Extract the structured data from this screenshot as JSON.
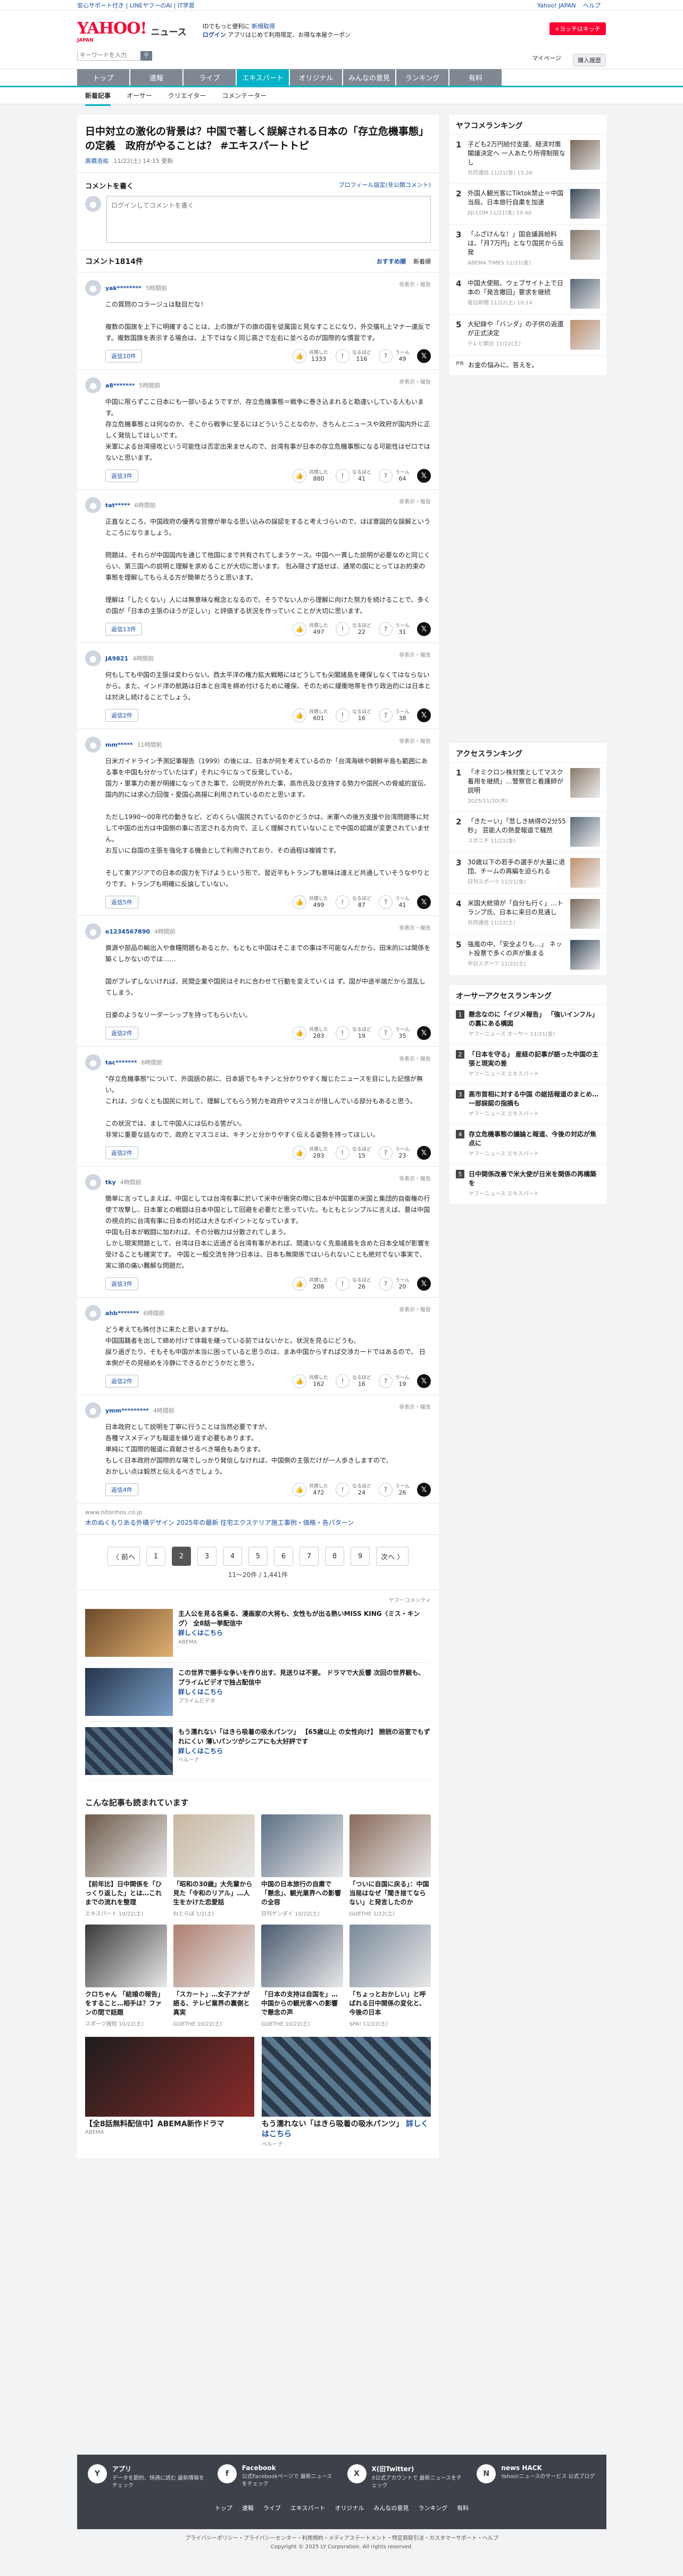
{
  "topbar": {
    "left_links": [
      "安心サポート付き | LINEヤフーのAI | IT学習"
    ],
    "right_links": [
      "Yahoo! JAPAN",
      "ヘルプ"
    ]
  },
  "header": {
    "logo": "YAHOO!",
    "logo_sub": "JAPAN",
    "section": "ニュース",
    "promo_line1": "IDでもっと便利に",
    "promo_new": "新規取得",
    "promo_login": "ログイン",
    "promo_line2": "アプリはじめて利用限定、お得な本屋クーポン",
    "search_button": "+ヨッチはキッチ",
    "right_text": "ポスト"
  },
  "searchrow": {
    "placeholder": "キーワードを入力",
    "mypage": "マイページ",
    "purchase": "購入履歴"
  },
  "nav": {
    "tabs": [
      "トップ",
      "速報",
      "ライブ",
      "エキスパート",
      "オリジナル",
      "みんなの意見",
      "ランキング",
      "有料"
    ],
    "active": "エキスパート"
  },
  "subnav": [
    "新着記事",
    "オーサー",
    "クリエイター",
    "コメンテーター"
  ],
  "article": {
    "title": "日中対立の激化の背景は？中国で著しく誤解される日本の「存立危機事態」の定義　政府がやることは？ #エキスパートトピ",
    "author": "高橋浩祐",
    "date": "11/22(土) 14:15 更新"
  },
  "comment_form": {
    "label": "コメントを書く",
    "link": "プロフィール設定(非公開コメント)",
    "placeholder": "ログインしてコメントを書く"
  },
  "comments_header": {
    "title": "コメント1814件",
    "sort1": "おすすめ順",
    "sort2": "新着順"
  },
  "vote_labels": {
    "agree": "共感した",
    "think": "なるほど",
    "hmm": "うーん",
    "report": "非表示・報告",
    "replies_label": "返信"
  },
  "comments": [
    {
      "user": "yak********",
      "time": "5時間前",
      "body": "この質問のコラージュは駄目だな！\n\n複数の国旗を上下に明確することは、上の旗が下の旗の国を従属国と見なすことになり、外交儀礼上マナー違反です。複数国旗を表示する場合は、上下ではなく同じ高さで左右に並べるのが国際的な慣習です。",
      "replies": "返信10件",
      "agree": "1333",
      "think": "116",
      "hmm": "49"
    },
    {
      "user": "a8*******",
      "time": "5時間前",
      "body": "中国に限らずここ日本にも一部いるようですが、存立危機事態＝戦争に巻き込まれると勘違いしている人もいます。\n存立危機事態とは何なのか、そこから戦争に至るにはどういうことなのか、きちんとニュースや政府が国内外に正しく発信してほしいです。\n米軍による台湾侵攻という可能性は否定出来ませんので、台湾有事が日本の存立危機事態になる可能性はゼロではないと思います。",
      "replies": "返信3件",
      "agree": "880",
      "think": "41",
      "hmm": "64"
    },
    {
      "user": "tat*****",
      "time": "6時間前",
      "body": "正直なところ、中国政府の優秀な官僚が単なる思い込みの誤認をすると考えづらいので、ほぼ意図的な誤解というところになりましょう。\n\n問題は、それらが中国国内を通じて他国にまで共有されてしまうケース。中国へ一貫した説明が必要なのと同じくらい、第三国への説明と理解を求めることが大切に思います。 包み隠さず話せば、通常の国にとってはお約束の事態を理解してもらえる方が簡単だろうと思います。\n\n理解は「したくない」人には無意味な概念となるので、そうでない人から理解に向けた努力を続けることで、多くの国が「日本の主張のほうが正しい」と評価する状況を作っていくことが大切に思います。",
      "replies": "返信13件",
      "agree": "497",
      "think": "22",
      "hmm": "31"
    },
    {
      "user": "JA9821",
      "time": "4時間前",
      "body": "何もしても中国の主張は変わらない。西太平洋の権力拡大戦略にはどうしても尖閣諸島を確保しなくてはならないから。また、インド洋の航路は日本と台湾を締め付けるために確保、そのために緩衝地帯を作り政治的には日本とは対決し続けることでしょう。",
      "replies": "返信2件",
      "agree": "601",
      "think": "16",
      "hmm": "38"
    },
    {
      "user": "mm*****",
      "time": "11時間前",
      "body": "日米ガイドライン予測記事報告（1999）の後には、日本が何を考えているのか「台湾海峡や朝鮮半島も範囲にある事を中国も分かっていたはず」それに今になって反発している。\n国力・軍事力の差が明確になってきた事で、公明党が外れた事、高市氏及び支持する勢力や国民への脅威的宣伝、国内的には求心力回復・愛国心高揚に利用されているのだと思います。\n\nただし1990〜00年代の動きなど、どのくらい国民されているのかどうかは、米軍への後方支援や台湾問題等に対して中国の出方は中国側の事に否定される方向で、正しく理解されていないことで中国の認識が変更されていません。\nお互いに自国の主張を強化する機会として利用されており、その過程は複雑です。\n\nそして東アジアでの日本の国力を下げようという形で、習近平もトランプも意味は違えど共通していそうなやりとりです。トランプも明確に反論していない。",
      "replies": "返信5件",
      "agree": "499",
      "think": "87",
      "hmm": "41"
    },
    {
      "user": "e1234567890",
      "time": "4時間前",
      "body": "資源や部品の輸出入や食糧問題もあるとか、もともと中国はそこまでの事は不可能なんだから、田末的には関係を築くしかないのでは……\n\n国がブレずしないければ、民間企業や国民はそれに合わせて行動を変えていくは ず。国が中途半端だから混乱してしまう。\n\n日豪のようなリーダーシップを持ってもらいたい。",
      "replies": "返信2件",
      "agree": "283",
      "think": "19",
      "hmm": "35"
    },
    {
      "user": "tac*******",
      "time": "6時間前",
      "body": "\"存立危機事態\"について、外国語の前に、日本語でもキチンと分かりやすく報じたニュースを目にした記憶が無い。\nこれは、少なくとも国民に対して、理解してもらう努力を政府やマスコミが惜しんでいる部分もあると思う。\n\nこの状況では、まして中国人には伝わる筈がい。\n非常に重要な話なので、政府とマスコミは、キチンと分かりやすく伝える姿勢を持ってほしい。",
      "replies": "返信2件",
      "agree": "283",
      "think": "15",
      "hmm": "23"
    },
    {
      "user": "tky",
      "time": "4時間前",
      "body": "簡単に言ってしまえば、中国としては台湾有事に於いて米中が衝突の際に日本が中国軍の米国と集団的自衛権の行使で攻撃し、日本軍との戦闘は日本中国として回避を必要だと思っていた。もともとシンプルに言えば、要は中国の視点的に台湾有事に日本の対応は大きなポイントとなっています。\n中国も日本が戦闘に加われば、その分戦力は分散されてしまう。\nしかし現実問題として、台湾は日本に近過ぎる台湾有事があれば、間違いなく先島諸島を含めた日本全域が影響を受けることも確実です。 中国と一般交流を持つ日本は、日本も無関係ではいられないことも絶対でない事実で、実に頭の痛い難解な問題だ。",
      "replies": "返信3件",
      "agree": "208",
      "think": "26",
      "hmm": "20"
    },
    {
      "user": "ahb*******",
      "time": "6時間前",
      "body": "どう考えても殊付きに来たと思いますがね。\n中国国籍者を出して締め付けて体裁を繕っている前ではないかと。状況を見るにどうも、\n誤り過ぎたり、そもそも中国が本当に困っていると思うのは、まあ中国からすれば交渉カードではあるので、 日本側がその見極めを冷静にできるかどうかだと思う。",
      "replies": "返信2件",
      "agree": "162",
      "think": "16",
      "hmm": "19"
    },
    {
      "user": "ymm*********",
      "time": "4時間前",
      "body": "日本政府として説明を丁寧に行うことは当然必要ですが、\n各種マスメディアも報道を繰り返す必要もあります。\n単純にて国際的報道に貢献させるべき場合もあります。\nもしく日本政府が国際的な場でしっかり発信しなければ、中国側の主張だけが一人歩きしますので、\nおかしい点は毅然と伝えるべきでしょう。",
      "replies": "返信4件",
      "agree": "472",
      "think": "24",
      "hmm": "26"
    }
  ],
  "ad_row": {
    "source": "www.nitorihos.co.jp",
    "title": "木のぬくもりある外構デザイン 2025年の最新 住宅エクステリア施工事例・価格・各パターン"
  },
  "pager": {
    "prev": "〈 前へ",
    "pages": [
      "1",
      "2",
      "3",
      "4",
      "5",
      "6",
      "7",
      "8",
      "9"
    ],
    "current": "2",
    "next": "次へ 〉",
    "info": "11〜20件 / 1,441件"
  },
  "ads": {
    "label": "ヤフーコメンティ",
    "items": [
      {
        "title": "主人公を見る名乗る、漫画家の大将も、女性もが出る熱いMISS KING〈ミス・キング〉 全8話一挙配信中",
        "more": "詳しくはこちら",
        "source": "ABEMA"
      },
      {
        "title": "この世界で勝手な争いを作り出す、見送りは不要。 ドラマで大反響 次回の世界観も、プライムビデオで独占配信中",
        "more": "詳しくはこちら",
        "source": "プライムビデオ"
      },
      {
        "title": "もう濡れない「はきら吸着の吸水パンツ」 【65歳以上 の女性向け】 膀胱の浴室でもずれにくい 薄いパンツがシニアにも大好評です",
        "more": "詳しくはこちら",
        "source": "ベルーナ"
      }
    ]
  },
  "recs": {
    "title": "こんな記事も読まれています",
    "cards": [
      {
        "title": "【前年比】日中関係を「ひっくり返した」とは…これまでの流れを整理",
        "source": "エキスパート 10/22(土)"
      },
      {
        "title": "「昭和の30歳」大先輩から見た「令和のリアル」…人生をかけた恋愛話",
        "source": "ねとらぼ 1/2(土)"
      },
      {
        "title": "中国の日本旅行の自粛で「懸念」、観光業界への影響の全容",
        "source": "日刊ゲンダイ 10/22(土)"
      },
      {
        "title": "「ついに自国に戻る」：中国当局はなぜ「聞き捨てならない」と発言したのか",
        "source": "GOETHE 1/22(土)"
      },
      {
        "title": "クロちゃん 「結婚の報告」をすること…相手は？ファンの間で話題",
        "source": "スポーツ報知 10/22(土)"
      },
      {
        "title": "「スカート」…女子アナが語る、テレビ業界の裏側と真実",
        "source": "GOETHE 10/22(土)"
      },
      {
        "title": "「日本の支持は自国を」…中国からの観光客への影響で懸念の声",
        "source": "GOETHE 10/22(土)"
      },
      {
        "title": "「ちょっとおかしい」と呼ばれる日中関係の変化と、今後の日本",
        "source": "SPA! 11/22(土)"
      }
    ],
    "big": [
      {
        "title": "【全8話無料配信中】ABEMA新作ドラマ",
        "source": "ABEMA"
      },
      {
        "title": "もう濡れない「はきら吸着の吸水パンツ」",
        "more": "詳しくはこちら",
        "source": "ベルーナ"
      }
    ]
  },
  "side": {
    "ranking_title": "ヤフコメランキング",
    "ranking": [
      {
        "num": "1",
        "title": "子ども2万円給付支援、経済対策 閣議決定へ 一人あたり所得制限なし",
        "date": "共同通信 11/21(金) 15:26"
      },
      {
        "num": "2",
        "title": "外国人観光客にTiktok禁止＝中国当局、日本旅行自粛を加速",
        "date": "JIJI.COM 11/21(金) 10:40"
      },
      {
        "num": "3",
        "title": "「ふざけんな！」国会議員給料は、「月7万円」となり国民から反発",
        "date": "ABEMA TIMES 11/21(金)"
      },
      {
        "num": "4",
        "title": "中国大使館、ウェブサイト上で日本の「発言撤回」要求を継続",
        "date": "毎日新聞 11/22(土) 10:14"
      },
      {
        "num": "5",
        "title": "大紀錄や「バンダ」の子供の返還が正式決定",
        "date": "テレビ朝日 11/22(土)"
      }
    ],
    "pr_label": "PR",
    "pr_text": "お金の悩みに、答えを。",
    "access_title": "アクセスランキング",
    "access": [
      {
        "num": "1",
        "title": "「オミクロン株対策としてマスク着用を継続」…警察官と看護師が説明",
        "date": "2025/11/20(木)"
      },
      {
        "num": "2",
        "title": "「きたーい」「悲しき納得の2分55秒」 芸能人の熱愛報道で騒然",
        "date": "スポニチ 11/21(金)"
      },
      {
        "num": "3",
        "title": "30歳以下の若手の選手が大量に退団、チームの再編を迫られる",
        "date": "日刊スポーツ 11/21(金)"
      },
      {
        "num": "4",
        "title": "米国大統領が「自分も行く」…トランプ氏、日本に来日の見通し",
        "date": "共同通信 11/22(土)"
      },
      {
        "num": "5",
        "title": "強風の中、「安全よりも…」 ネット投票で多くの声が集まる",
        "date": "中日スポーツ 11/22(土)"
      }
    ],
    "author_title": "オーサーアクセスランキング",
    "author_rank": [
      {
        "num": "1",
        "title": "懸念なのに「イジメ報告」 「強いインフル」 の裏にある構図",
        "date": "ヤフーニュース オーサー 11/21(金)"
      },
      {
        "num": "2",
        "title": "「日本を守る」 産経の記事が語った中国の主張と現実の差",
        "date": "ヤフーニュース エキスパート"
      },
      {
        "num": "3",
        "title": "高市首相に対する中国 の総括報道のまとめ…一部誤認の指摘も",
        "date": "ヤフーニュース エキスパート"
      },
      {
        "num": "4",
        "title": "存立危機事態の議論と報道、今後の対応が焦点に",
        "date": "ヤフーニュース エキスパート"
      },
      {
        "num": "5",
        "title": "日中関係改善で米大使が日米を関係の再構築を",
        "date": "ヤフーニュース エキスパート"
      }
    ]
  },
  "footer": {
    "cols": [
      {
        "icon": "Y",
        "title": "アプリ",
        "desc": "データを節約、快適に読む 最新情報をチェック"
      },
      {
        "icon": "f",
        "title": "Facebook",
        "desc": "公式Facebookページで 最新ニュースをチェック"
      },
      {
        "icon": "X",
        "title": "X(旧Twitter)",
        "desc": "X公式アカウントで 最新ニュースをチェック"
      },
      {
        "icon": "N",
        "title": "news HACK",
        "desc": "Yahoo!ニュースのサービス 公式ブログ"
      }
    ],
    "nav": [
      "トップ",
      "速報",
      "ライブ",
      "エキスパート",
      "オリジナル",
      "みんなの意見",
      "ランキング",
      "有料"
    ],
    "legal1": "プライバシーポリシー・プライバシーセンター・利用規約・メディアステートメント・特定商取引法・カスタマーサポート・ヘルプ",
    "legal2": "Copyright © 2025 LY Corporation. All rights reserved."
  }
}
